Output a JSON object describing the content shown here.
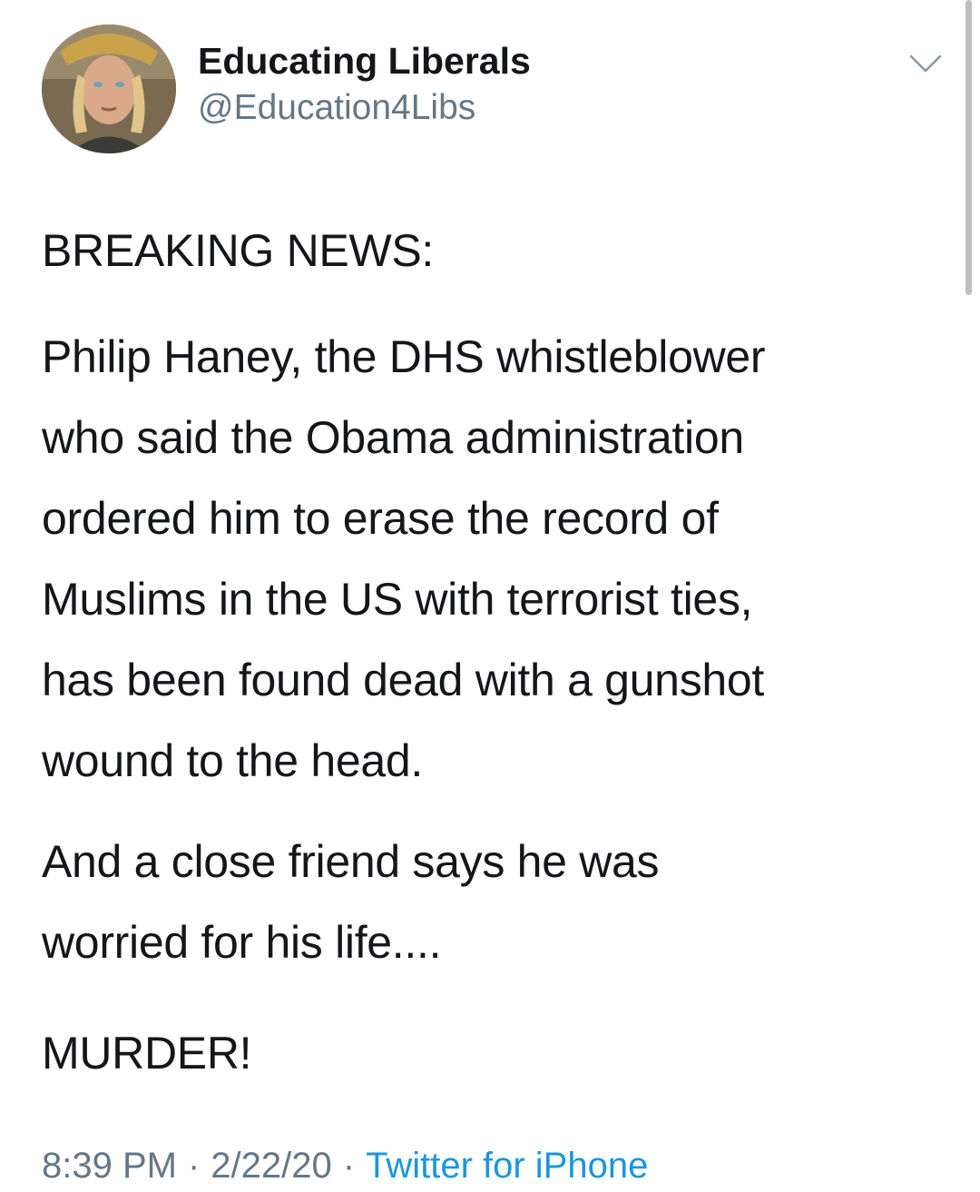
{
  "author": {
    "display_name": "Educating Liberals",
    "handle": "@Education4Libs",
    "avatar_icon": "profile-photo"
  },
  "menu_icon": "chevron-down-icon",
  "tweet": {
    "paragraphs": [
      "BREAKING NEWS:",
      "Philip Haney, the DHS whistleblower\nwho said the Obama administration\nordered him to erase the record of\nMuslims in the US with terrorist ties,\nhas been found dead with a gunshot\nwound to the head.",
      "And a close friend says he was\nworried for his life....",
      "MURDER!"
    ]
  },
  "meta": {
    "time": "8:39 PM",
    "separator": "·",
    "date": "2/22/20",
    "source": "Twitter for iPhone"
  },
  "colors": {
    "text": "#14171a",
    "secondary": "#657786",
    "link": "#1b95e0",
    "background": "#ffffff"
  }
}
